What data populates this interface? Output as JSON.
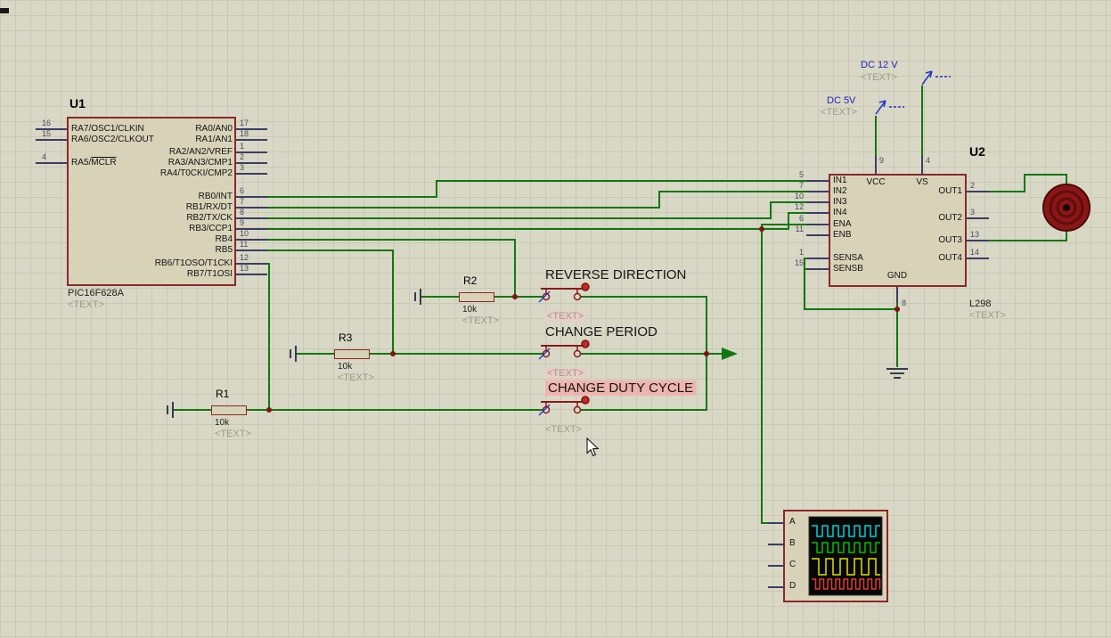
{
  "u1": {
    "ref": "U1",
    "part": "PIC16F628A",
    "text_placeholder": "<TEXT>",
    "left_pins": [
      {
        "name": "RA7/OSC1/CLKIN",
        "num": "16"
      },
      {
        "name": "RA6/OSC2/CLKOUT",
        "num": "15"
      },
      {
        "name": "RA5/MCLR",
        "overline": "MCLR",
        "num": "4"
      }
    ],
    "right_pins": [
      {
        "name": "RA0/AN0",
        "num": "17"
      },
      {
        "name": "RA1/AN1",
        "num": "18"
      },
      {
        "name": "RA2/AN2/VREF",
        "num": "1"
      },
      {
        "name": "RA3/AN3/CMP1",
        "num": "2"
      },
      {
        "name": "RA4/T0CKI/CMP2",
        "num": "3"
      },
      {
        "name": "RB0/INT",
        "num": "6"
      },
      {
        "name": "RB1/RX/DT",
        "num": "7"
      },
      {
        "name": "RB2/TX/CK",
        "num": "8"
      },
      {
        "name": "RB3/CCP1",
        "num": "9"
      },
      {
        "name": "RB4",
        "num": "10"
      },
      {
        "name": "RB5",
        "num": "11"
      },
      {
        "name": "RB6/T1OSO/T1CKI",
        "num": "12"
      },
      {
        "name": "RB7/T1OSI",
        "num": "13"
      }
    ]
  },
  "u2": {
    "ref": "U2",
    "part": "L298",
    "text_placeholder": "<TEXT>",
    "left_pins": [
      {
        "name": "IN1",
        "num": "5"
      },
      {
        "name": "IN2",
        "num": "7"
      },
      {
        "name": "IN3",
        "num": "10"
      },
      {
        "name": "IN4",
        "num": "12"
      },
      {
        "name": "ENA",
        "num": "6"
      },
      {
        "name": "ENB",
        "num": "11"
      },
      {
        "name": "SENSA",
        "num": "1"
      },
      {
        "name": "SENSB",
        "num": "15"
      }
    ],
    "right_pins": [
      {
        "name": "OUT1",
        "num": "2"
      },
      {
        "name": "OUT2",
        "num": "3"
      },
      {
        "name": "OUT3",
        "num": "13"
      },
      {
        "name": "OUT4",
        "num": "14"
      }
    ],
    "top_pins": [
      {
        "name": "VCC",
        "num": "9"
      },
      {
        "name": "VS",
        "num": "4"
      }
    ],
    "bottom_pins": [
      {
        "name": "GND",
        "num": "8"
      }
    ]
  },
  "resistors": [
    {
      "ref": "R2",
      "value": "10k",
      "text": "<TEXT>"
    },
    {
      "ref": "R3",
      "value": "10k",
      "text": "<TEXT>"
    },
    {
      "ref": "R1",
      "value": "10k",
      "text": "<TEXT>"
    }
  ],
  "buttons": [
    {
      "label": "REVERSE DIRECTION",
      "placeholder": "<TEXT>",
      "label_highlight": false,
      "placeholder_highlight": true
    },
    {
      "label": "CHANGE PERIOD",
      "placeholder": "<TEXT>",
      "label_highlight": false,
      "placeholder_highlight": true
    },
    {
      "label": "CHANGE DUTY CYCLE",
      "placeholder": "<TEXT>",
      "label_highlight": true,
      "placeholder_highlight": false
    }
  ],
  "power": [
    {
      "label": "DC 12 V",
      "text": "<TEXT>"
    },
    {
      "label": "DC 5V",
      "text": "<TEXT>"
    }
  ],
  "oscilloscope": {
    "channels": [
      {
        "label": "A",
        "color": "#00d2d2"
      },
      {
        "label": "B",
        "color": "#00c000"
      },
      {
        "label": "C",
        "color": "#e0e000"
      },
      {
        "label": "D",
        "color": "#e03838"
      }
    ]
  }
}
